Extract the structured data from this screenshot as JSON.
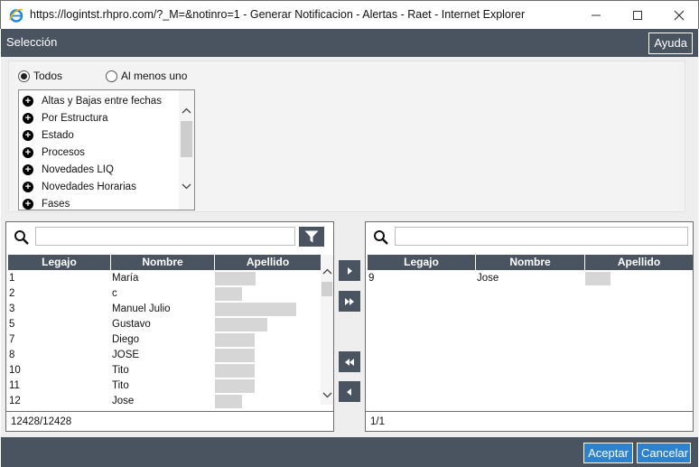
{
  "window": {
    "title": "https://logintst.rhpro.com/?_M=&notinro=1 - Generar Notificacion - Alertas - Raet - Internet Explorer",
    "icons": [
      "ie-icon",
      "minimize-icon",
      "maximize-icon",
      "close-icon"
    ]
  },
  "dialog": {
    "title": "Selección",
    "help_label": "Ayuda"
  },
  "filters": {
    "radio_all": "Todos",
    "radio_any": "Al menos uno",
    "selected": "Todos",
    "tree_items": [
      "Altas y Bajas entre fechas",
      "Por Estructura",
      "Estado",
      "Procesos",
      "Novedades LIQ",
      "Novedades Horarias",
      "Fases"
    ]
  },
  "left_list": {
    "search_value": "",
    "columns": [
      "Legajo",
      "Nombre",
      "Apellido"
    ],
    "rows": [
      {
        "legajo": "1",
        "nombre": "María"
      },
      {
        "legajo": "2",
        "nombre": "c"
      },
      {
        "legajo": "3",
        "nombre": "Manuel Julio"
      },
      {
        "legajo": "5",
        "nombre": "Gustavo"
      },
      {
        "legajo": "7",
        "nombre": "Diego"
      },
      {
        "legajo": "8",
        "nombre": "JOSE"
      },
      {
        "legajo": "10",
        "nombre": "Tito"
      },
      {
        "legajo": "11",
        "nombre": "Tito"
      },
      {
        "legajo": "12",
        "nombre": "Jose"
      }
    ],
    "count": "12428/12428"
  },
  "right_list": {
    "search_value": "",
    "columns": [
      "Legajo",
      "Nombre",
      "Apellido"
    ],
    "rows": [
      {
        "legajo": "9",
        "nombre": "Jose"
      }
    ],
    "count": "1/1"
  },
  "actions": {
    "accept": "Aceptar",
    "cancel": "Cancelar"
  },
  "colors": {
    "header_bg": "#4a5360",
    "accent": "#2c82cd"
  }
}
